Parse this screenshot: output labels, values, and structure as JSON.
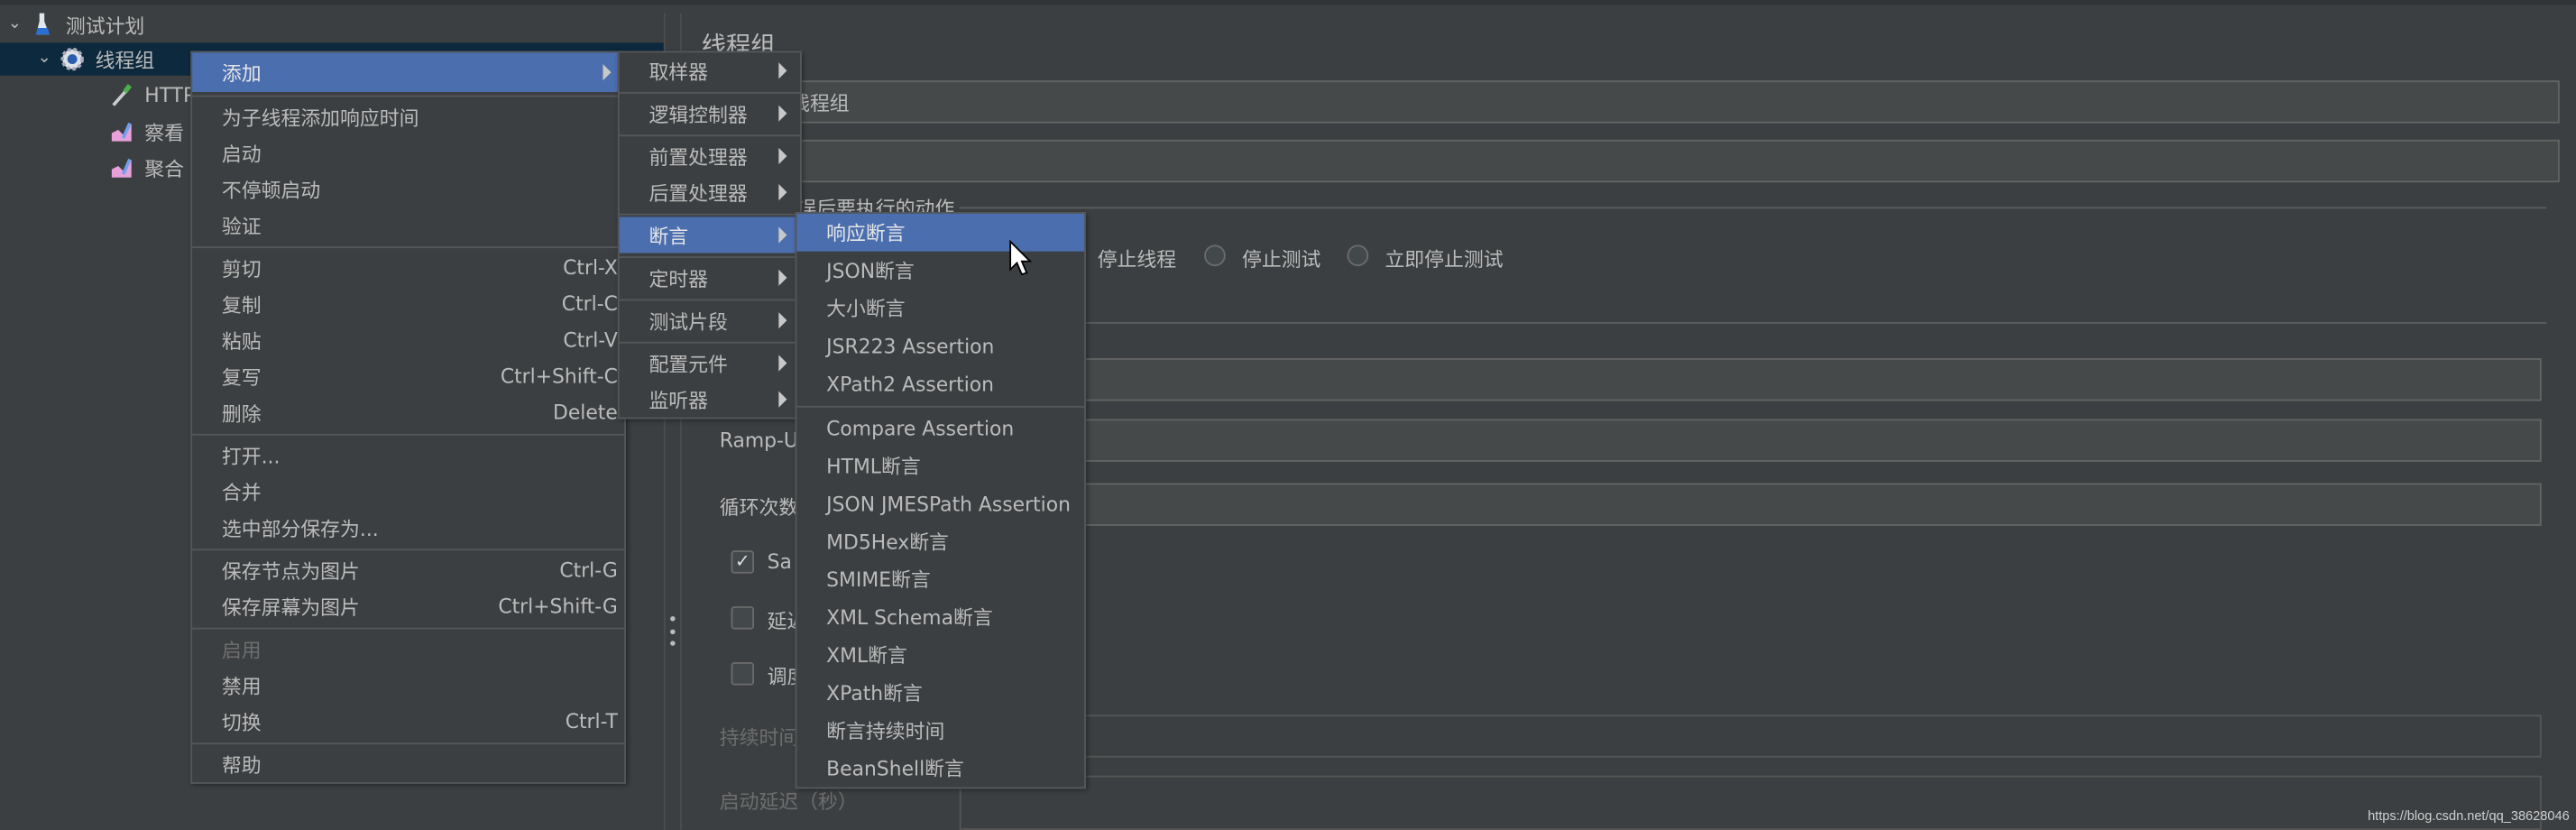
{
  "tree": {
    "items": [
      {
        "label": "测试计划",
        "icon": "flask-icon",
        "expanded": true
      },
      {
        "label": "线程组",
        "icon": "gear-icon",
        "expanded": true,
        "selected": true
      },
      {
        "label": "HTTP",
        "icon": "pipette-icon"
      },
      {
        "label": "察看",
        "icon": "graph-icon"
      },
      {
        "label": "聚合",
        "icon": "graph-icon"
      }
    ]
  },
  "panel": {
    "title": "线程组",
    "name_value": "线程组",
    "error_action_legend": "错误后要执行的动作",
    "radios": [
      "停止线程",
      "停止测试",
      "立即停止测试"
    ],
    "ramp_up_label": "Ramp-U",
    "loop_label": "循环次数",
    "same_user_label": "Sa",
    "same_user_checked": true,
    "delay_label": "延迟",
    "scheduler_label": "调度",
    "duration_label": "持续时间",
    "startup_delay_label": "启动延迟（秒）"
  },
  "context_menu": {
    "groups": [
      [
        {
          "label": "添加",
          "submenu": true,
          "highlighted": true
        }
      ],
      [
        {
          "label": "为子线程添加响应时间"
        },
        {
          "label": "启动"
        },
        {
          "label": "不停顿启动"
        },
        {
          "label": "验证"
        }
      ],
      [
        {
          "label": "剪切",
          "shortcut": "Ctrl-X"
        },
        {
          "label": "复制",
          "shortcut": "Ctrl-C"
        },
        {
          "label": "粘贴",
          "shortcut": "Ctrl-V"
        },
        {
          "label": "复写",
          "shortcut": "Ctrl+Shift-C"
        },
        {
          "label": "删除",
          "shortcut": "Delete"
        }
      ],
      [
        {
          "label": "打开..."
        },
        {
          "label": "合并"
        },
        {
          "label": "选中部分保存为..."
        }
      ],
      [
        {
          "label": "保存节点为图片",
          "shortcut": "Ctrl-G"
        },
        {
          "label": "保存屏幕为图片",
          "shortcut": "Ctrl+Shift-G"
        }
      ],
      [
        {
          "label": "启用",
          "disabled": true
        },
        {
          "label": "禁用"
        },
        {
          "label": "切换",
          "shortcut": "Ctrl-T"
        }
      ],
      [
        {
          "label": "帮助"
        }
      ]
    ]
  },
  "add_submenu": {
    "groups": [
      [
        {
          "label": "取样器"
        }
      ],
      [
        {
          "label": "逻辑控制器"
        }
      ],
      [
        {
          "label": "前置处理器"
        },
        {
          "label": "后置处理器"
        }
      ],
      [
        {
          "label": "断言",
          "highlighted": true
        }
      ],
      [
        {
          "label": "定时器"
        }
      ],
      [
        {
          "label": "测试片段"
        }
      ],
      [
        {
          "label": "配置元件"
        },
        {
          "label": "监听器"
        }
      ]
    ]
  },
  "assertion_submenu": {
    "groups": [
      [
        {
          "label": "响应断言",
          "highlighted": true
        },
        {
          "label": "JSON断言"
        },
        {
          "label": "大小断言"
        },
        {
          "label": "JSR223 Assertion"
        },
        {
          "label": "XPath2 Assertion"
        }
      ],
      [
        {
          "label": "Compare Assertion"
        },
        {
          "label": "HTML断言"
        },
        {
          "label": "JSON JMESPath Assertion"
        },
        {
          "label": "MD5Hex断言"
        },
        {
          "label": "SMIME断言"
        },
        {
          "label": "XML Schema断言"
        },
        {
          "label": "XML断言"
        },
        {
          "label": "XPath断言"
        },
        {
          "label": "断言持续时间"
        },
        {
          "label": "BeanShell断言"
        }
      ]
    ]
  },
  "watermark": "https://blog.csdn.net/qq_38628046",
  "colors": {
    "background": "#3c3f41",
    "highlight": "#4b6eaf",
    "tree_selection": "#0d293e",
    "text": "#bbbbbb"
  }
}
